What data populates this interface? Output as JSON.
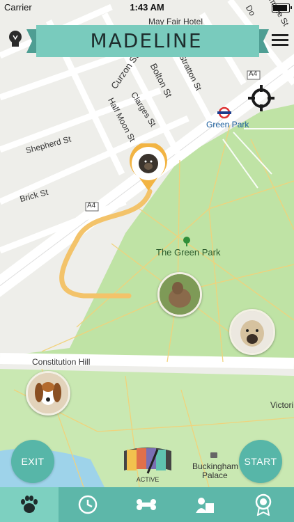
{
  "status_bar": {
    "carrier": "Carrier",
    "time": "1:43 AM"
  },
  "header": {
    "title": "MADELINE"
  },
  "map": {
    "labels": {
      "mayfair": "May Fair Hotel",
      "curzon": "Curzon St",
      "bolton": "Bolton St",
      "stratton": "Stratton St",
      "clarges": "Clarges St",
      "halfmoon": "Half Moon St",
      "shepherd": "Shepherd St",
      "brick": "Brick St",
      "a4_top": "A4",
      "a4_left": "A4",
      "greenpark_station": "Green Park",
      "the_green_park": "The Green Park",
      "constitution": "Constitution Hill",
      "victoria": "Victori",
      "buckingham_1": "Buckingham",
      "buckingham_2": "Palace",
      "dover": "Do",
      "albemarle": "marle St"
    }
  },
  "controls": {
    "exit_label": "EXIT",
    "start_label": "START",
    "active_label": "ACTIVE"
  },
  "colors": {
    "accent": "#57b6a8",
    "park": "#bfe3a5",
    "route": "#f3c36a",
    "pin": "#f2b443"
  },
  "tabbar": {
    "items": [
      "paw-icon",
      "clock-icon",
      "bone-icon",
      "person-card-icon",
      "award-icon"
    ],
    "active_index": 0
  }
}
